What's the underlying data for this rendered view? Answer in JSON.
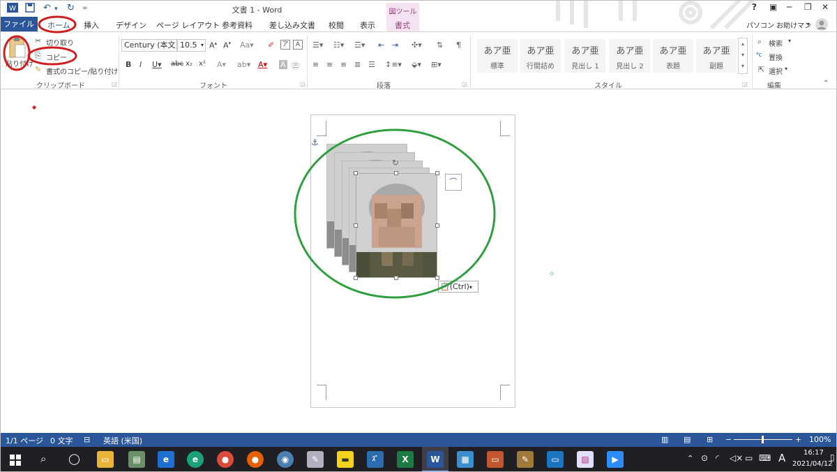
{
  "titlebar": {
    "title": "文書 1 - Word",
    "help": "?",
    "min": "─",
    "restore": "❐",
    "close": "✕",
    "user": "パソコン お助けマン"
  },
  "tabs": {
    "file": "ファイル",
    "home": "ホーム",
    "insert": "挿入",
    "design": "デザイン",
    "layout": "ページ レイアウト",
    "references": "参考資料",
    "mailings": "差し込み文書",
    "review": "校閲",
    "view": "表示",
    "context_group": "図ツール",
    "format": "書式"
  },
  "ribbon": {
    "clipboard": {
      "paste": "貼り付け",
      "cut": "切り取り",
      "copy": "コピー",
      "format_painter": "書式のコピー/貼り付け",
      "label": "クリップボード"
    },
    "font": {
      "name": "Century (本文",
      "size": "10.5",
      "label": "フォント"
    },
    "paragraph": {
      "label": "段落"
    },
    "styles": {
      "label": "スタイル",
      "items": [
        {
          "sample": "あア亜",
          "name": "標準"
        },
        {
          "sample": "あア亜",
          "name": "行間詰め"
        },
        {
          "sample": "あア亜",
          "name": "見出し 1"
        },
        {
          "sample": "あア亜",
          "name": "見出し 2"
        },
        {
          "sample": "あア亜",
          "name": "表題"
        },
        {
          "sample": "あア亜",
          "name": "副題"
        }
      ]
    },
    "editing": {
      "find": "検索",
      "replace": "置換",
      "select": "選択",
      "label": "編集"
    }
  },
  "document": {
    "paste_options": "(Ctrl)"
  },
  "statusbar": {
    "page": "1/1 ページ",
    "words": "0 文字",
    "language": "英語 (米国)",
    "zoom": "100%"
  },
  "taskbar": {
    "time": "16:17",
    "date": "2021/04/12",
    "ime": "A"
  },
  "colors": {
    "accent": "#2b579a",
    "annotation_red": "#d01c1c",
    "annotation_green": "#2f9e3f"
  }
}
